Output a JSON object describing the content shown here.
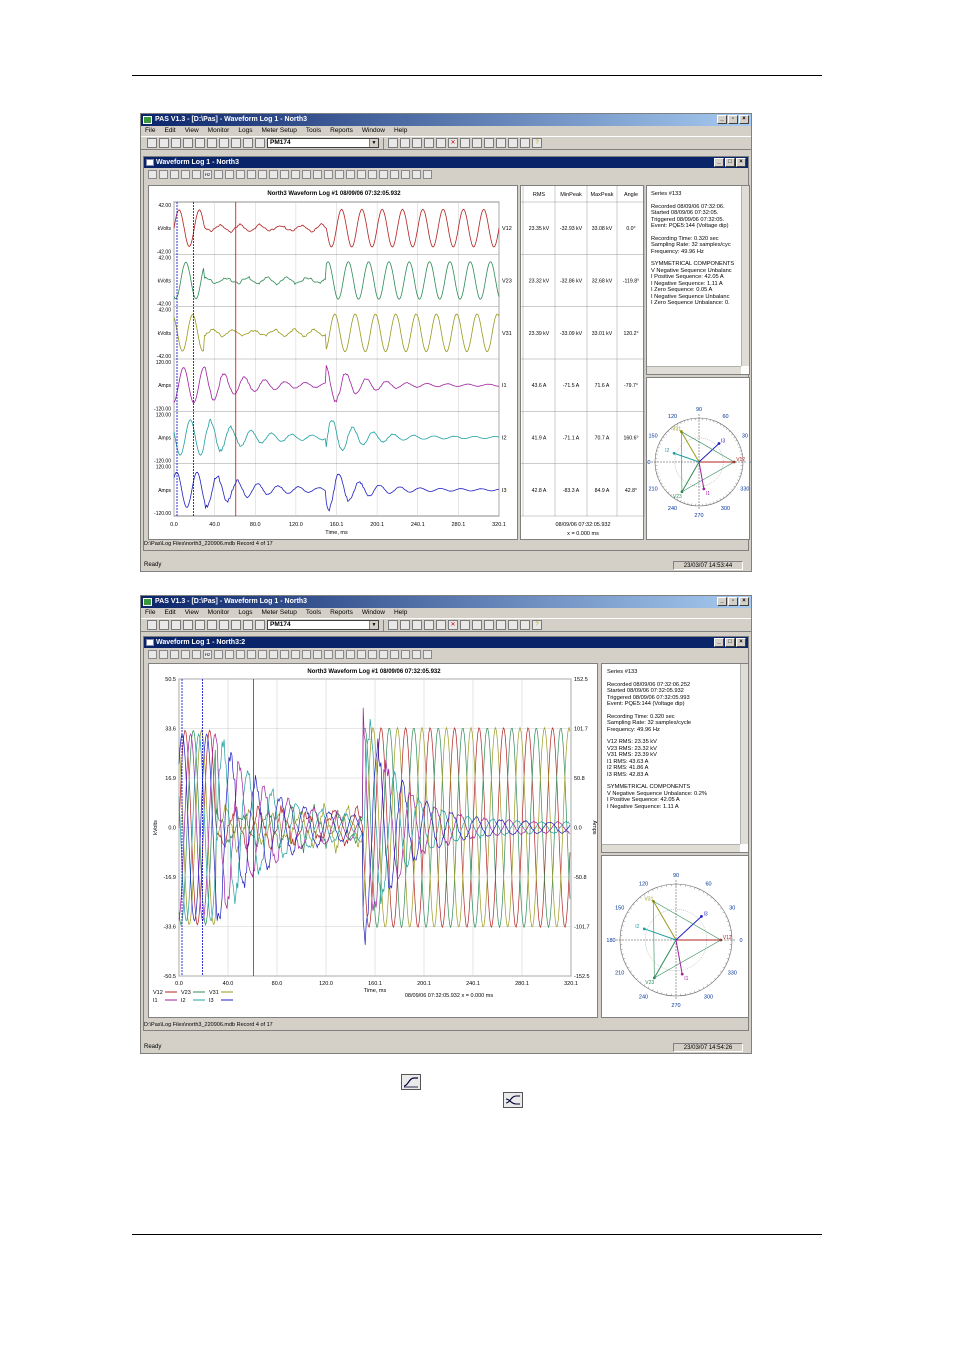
{
  "screen1": {
    "title": "PAS V1.3 - [D:\\Pas] - Waveform Log 1 - North3",
    "menu": [
      "File",
      "Edit",
      "View",
      "Monitor",
      "Logs",
      "Meter Setup",
      "Tools",
      "Reports",
      "Window",
      "Help"
    ],
    "device": "PM174",
    "child_title": "Waveform Log 1 - North3",
    "plot_title": "North3  Waveform Log #1   08/09/06  07:32:05.932",
    "channels": [
      {
        "name": "V12",
        "unit": "kVolts",
        "top": "42.00",
        "bottom": "-42.00",
        "color": "#b22222",
        "rms": "23.35 kV",
        "minpeak": "-32.93 kV",
        "maxpeak": "33.08 kV",
        "angle": "0.0°"
      },
      {
        "name": "V23",
        "unit": "kVolts",
        "top": "42.00",
        "bottom": "-42.00",
        "color": "#2e8b57",
        "rms": "23.32 kV",
        "minpeak": "-32.86 kV",
        "maxpeak": "32.68 kV",
        "angle": "-119.8°"
      },
      {
        "name": "V31",
        "unit": "kVolts",
        "top": "42.00",
        "bottom": "-42.00",
        "color": "#9a9a20",
        "rms": "23.39 kV",
        "minpeak": "-33.09 kV",
        "maxpeak": "33.01 kV",
        "angle": "120.2°"
      },
      {
        "name": "I1",
        "unit": "Amps",
        "top": "120.00",
        "bottom": "-120.00",
        "color": "#a020a0",
        "rms": "43.6 A",
        "minpeak": "-71.5 A",
        "maxpeak": "71.6 A",
        "angle": "-79.7°"
      },
      {
        "name": "I2",
        "unit": "Amps",
        "top": "120.00",
        "bottom": "-120.00",
        "color": "#1fa0a0",
        "rms": "41.9 A",
        "minpeak": "-71.1 A",
        "maxpeak": "70.7 A",
        "angle": "160.6°"
      },
      {
        "name": "I3",
        "unit": "Amps",
        "top": "120.00",
        "bottom": "-120.00",
        "color": "#2020c0",
        "rms": "42.8 A",
        "minpeak": "-83.3 A",
        "maxpeak": "84.9 A",
        "angle": "42.8°"
      }
    ],
    "table_headers": [
      "RMS",
      "MinPeak",
      "MaxPeak",
      "Angle"
    ],
    "x_ticks": [
      "0.0",
      "40.0",
      "80.0",
      "120.0",
      "160.1",
      "200.1",
      "240.1",
      "280.1",
      "320.1"
    ],
    "x_label": "Time, ms",
    "table_footer": [
      "08/09/06  07:32:05.932",
      "x = 0.000 ms"
    ],
    "info": [
      "Series #133",
      "",
      "Recorded 08/09/06  07:32:06.",
      "Started     08/09/06  07:32:05.",
      "Triggered  08/09/06  07:32:05.",
      "Event: PQE5:144 (Voltage dip)",
      "",
      "Recording Time: 0.320 sec",
      "Sampling Rate: 32 samples/cyc",
      "Frequency: 49.96 Hz",
      "",
      "SYMMETRICAL COMPONENTS",
      "V Negative Sequence Unbalanc",
      "I Positive Sequence: 42.05 A",
      "I Negative Sequence: 1.11 A",
      "I Zero Sequence: 0.05 A",
      "I Negative Sequence Unbalanc",
      "I Zero Sequence Unbalance: 0."
    ],
    "file_status": "D:\\Pas\\Log Files\\north3_220906.mdb   Record 4 of 17",
    "status": "Ready",
    "clock": "23/03/07  14:53:44"
  },
  "screen2": {
    "title": "PAS V1.3 - [D:\\Pas] - Waveform Log 1 - North3",
    "menu": [
      "File",
      "Edit",
      "View",
      "Monitor",
      "Logs",
      "Meter Setup",
      "Tools",
      "Reports",
      "Window",
      "Help"
    ],
    "device": "PM174",
    "child_title": "Waveform Log 1 - North3:2",
    "plot_title": "North3  Waveform Log #1   08/09/06  07:32:05.932",
    "y_left": [
      "50.5",
      "33.6",
      "16.9",
      "0.0",
      "-16.9",
      "-33.6",
      "-50.5"
    ],
    "y_right": [
      "152.5",
      "101.7",
      "50.8",
      "0.0",
      "-50.8",
      "-101.7",
      "-152.5"
    ],
    "y_left_label": "kVolts",
    "y_right_label": "Amps",
    "x_ticks": [
      "0.0",
      "40.0",
      "80.0",
      "120.0",
      "160.1",
      "200.1",
      "240.1",
      "280.1",
      "320.1"
    ],
    "x_label": "Time, ms",
    "legend1": [
      "V12",
      "V23",
      "V31"
    ],
    "legend2": [
      "I1",
      "I2",
      "I3"
    ],
    "footer": "08/09/06  07:32:05.932   x = 0.000 ms",
    "info": [
      "Series #133",
      "",
      "Recorded 08/09/06  07:32:06.252",
      "Started     08/09/06  07:32:05.932",
      "Triggered  08/09/06  07:32:05.993",
      "Event: PQE5:144 (Voltage dip)",
      "",
      "Recording Time: 0.320 sec",
      "Sampling Rate: 32 samples/cycle",
      "Frequency: 49.96 Hz",
      "",
      "V12 RMS: 23.35 kV",
      "V23 RMS: 23.32 kV",
      "V31 RMS: 23.39 kV",
      "I1 RMS: 43.63 A",
      "I2 RMS: 41.86 A",
      "I3 RMS: 42.83 A",
      "",
      "SYMMETRICAL COMPONENTS",
      "V Negative Sequence Unbalance: 0.2%",
      "I Positive Sequence: 42.05 A",
      "I Negative Sequence: 1.11 A"
    ],
    "file_status": "D:\\Pas\\Log Files\\north3_220906.mdb   Record 4 of 17",
    "status": "Ready",
    "clock": "23/03/07  14:54:26"
  },
  "phasor": {
    "angles": [
      "90",
      "60",
      "30",
      "0",
      "330",
      "300",
      "270",
      "240",
      "210",
      "180",
      "150",
      "120"
    ],
    "labels": [
      "V12",
      "V23",
      "V31",
      "I1",
      "I2",
      "I3"
    ]
  }
}
